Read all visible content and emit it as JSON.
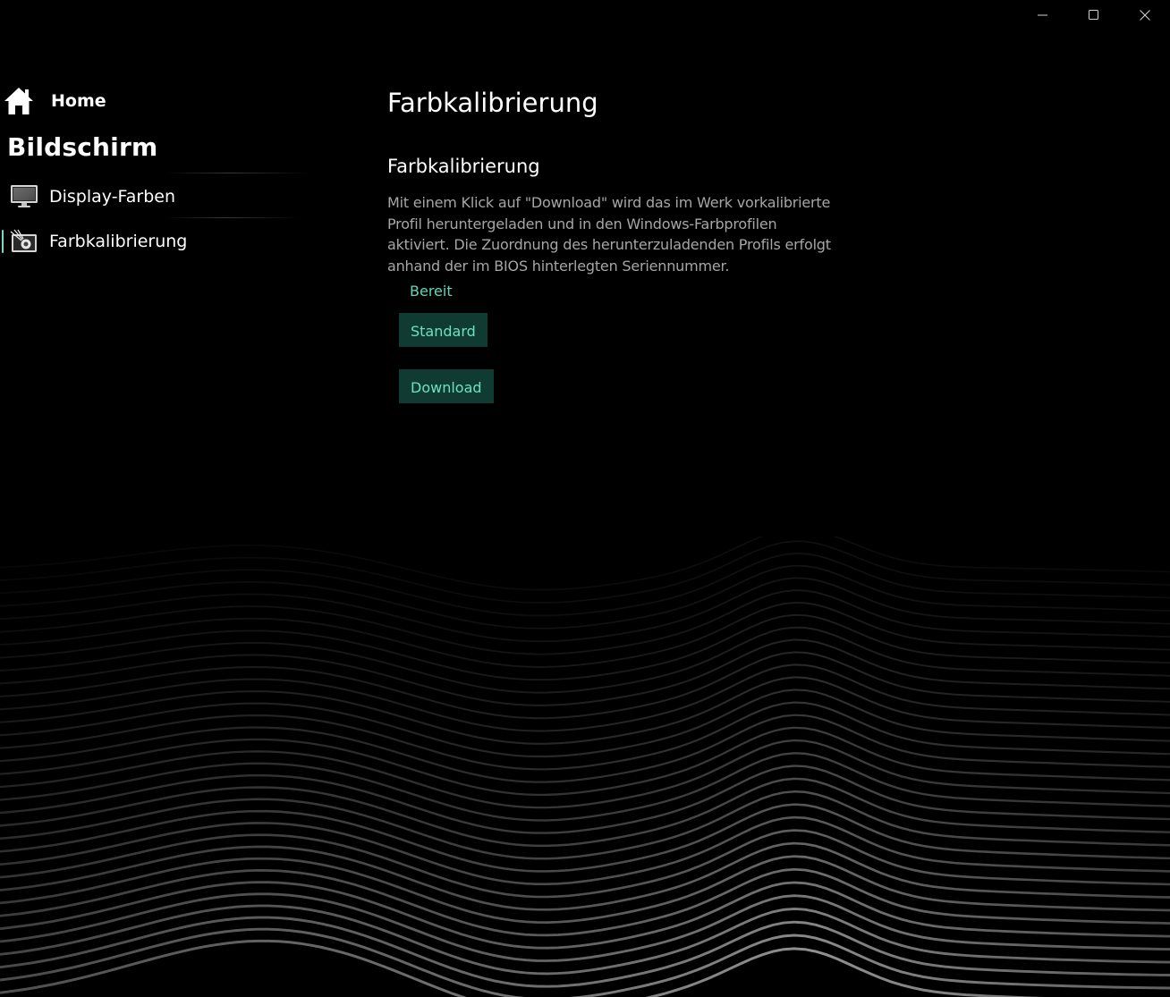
{
  "window": {
    "controls": {
      "minimize_icon": "minimize-icon",
      "maximize_icon": "maximize-icon",
      "close_icon": "close-icon"
    }
  },
  "sidebar": {
    "home": {
      "label": "Home",
      "icon": "home-icon"
    },
    "section_title": "Bildschirm",
    "items": [
      {
        "label": "Display-Farben",
        "icon": "monitor-icon",
        "selected": false
      },
      {
        "label": "Farbkalibrierung",
        "icon": "color-calibration-icon",
        "selected": true
      }
    ]
  },
  "main": {
    "page_title": "Farbkalibrierung",
    "section_title": "Farbkalibrierung",
    "description": "Mit einem Klick auf \"Download\" wird das im Werk vorkalibrierte Profil heruntergeladen und in den Windows-Farbprofilen aktiviert. Die Zuordnung des herunterzuladenden Profils erfolgt anhand der im BIOS hinterlegten Seriennummer.",
    "status": "Bereit",
    "buttons": {
      "standard": "Standard",
      "download": "Download"
    }
  },
  "colors": {
    "background": "#000000",
    "accent_text": "#6fe0c3",
    "button_background": "#0f3b33",
    "description_text": "#a6a6a6",
    "status_text": "#5fd6b8"
  }
}
